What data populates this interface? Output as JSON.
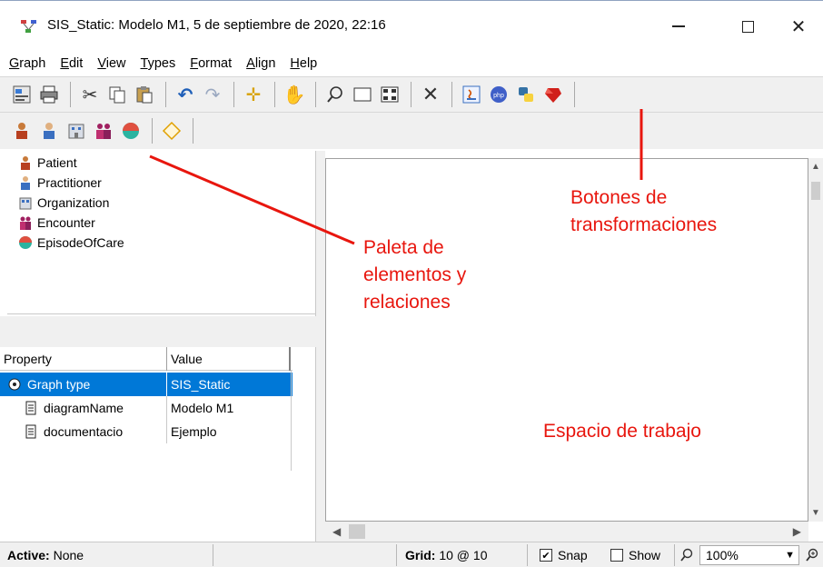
{
  "window": {
    "title": "SIS_Static: Modelo M1, 5 de septiembre de 2020, 22:16",
    "minimize_glyph": "—",
    "close_glyph": "✕"
  },
  "menu": [
    "Graph",
    "Edit",
    "View",
    "Types",
    "Format",
    "Align",
    "Help"
  ],
  "palette": {
    "items": [
      {
        "label": "Patient",
        "icon": "patient-icon"
      },
      {
        "label": "Practitioner",
        "icon": "practitioner-icon"
      },
      {
        "label": "Organization",
        "icon": "organization-icon"
      },
      {
        "label": "Encounter",
        "icon": "encounter-icon"
      },
      {
        "label": "EpisodeOfCare",
        "icon": "episode-of-care-icon"
      }
    ]
  },
  "properties": {
    "headers": {
      "property": "Property",
      "value": "Value"
    },
    "rows": [
      {
        "property": "Graph type",
        "value": "SIS_Static",
        "selected": true
      },
      {
        "property": "diagramName",
        "value": "Modelo M1",
        "selected": false
      },
      {
        "property": "documentacio",
        "value": "Ejemplo",
        "selected": false
      }
    ]
  },
  "annotations": {
    "transform_buttons": [
      "Botones de",
      "transformaciones"
    ],
    "palette_note": [
      "Paleta de",
      "elementos y",
      "relaciones"
    ],
    "workspace": "Espacio de trabajo"
  },
  "status": {
    "active_label": "Active:",
    "active_value": "None",
    "grid_label": "Grid:",
    "grid_value": "10 @ 10",
    "snap_label": "Snap",
    "snap_checked": true,
    "show_label": "Show",
    "show_checked": false,
    "zoom": "100%"
  },
  "colors": {
    "annotation": "#e8160e",
    "selection": "#0078d7"
  }
}
